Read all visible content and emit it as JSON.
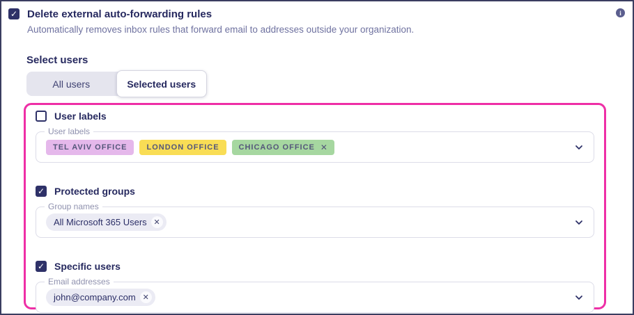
{
  "colors": {
    "accent_pink": "#ee2fa6",
    "dark_navy_text": "#26295f",
    "muted_text": "#6f72a0",
    "checkbox_fill": "#2e3168",
    "segment_track": "#e5e5ee",
    "chip_lilac": "#e5b8eb",
    "chip_yellow": "#f9dd55",
    "chip_green": "#a6d7a0",
    "chip_pill_bg": "#ebebf4",
    "field_border": "#dcdce8"
  },
  "icons": {
    "check": "✓",
    "remove": "✕",
    "info": "i"
  },
  "header": {
    "checkbox_checked": true,
    "title": "Delete external auto-forwarding rules",
    "description": "Automatically removes inbox rules that forward email to addresses outside your organization."
  },
  "select_users": {
    "heading": "Select users",
    "tabs": [
      {
        "label": "All users",
        "selected": false
      },
      {
        "label": "Selected users",
        "selected": true
      }
    ]
  },
  "filters": {
    "user_labels": {
      "checked": false,
      "checkbox_label": "User labels",
      "field_label": "User labels",
      "chips": [
        {
          "label": "TEL AVIV OFFICE",
          "color": "#e5b8eb",
          "removable": false
        },
        {
          "label": "LONDON OFFICE",
          "color": "#f9dd55",
          "removable": false
        },
        {
          "label": "CHICAGO OFFICE",
          "color": "#a6d7a0",
          "removable": true
        }
      ]
    },
    "protected_groups": {
      "checked": true,
      "checkbox_label": "Protected groups",
      "field_label": "Group names",
      "chips": [
        {
          "label": "All Microsoft 365 Users",
          "removable": true
        }
      ]
    },
    "specific_users": {
      "checked": true,
      "checkbox_label": "Specific users",
      "field_label": "Email addresses",
      "chips": [
        {
          "label": "john@company.com",
          "removable": true
        }
      ]
    }
  }
}
